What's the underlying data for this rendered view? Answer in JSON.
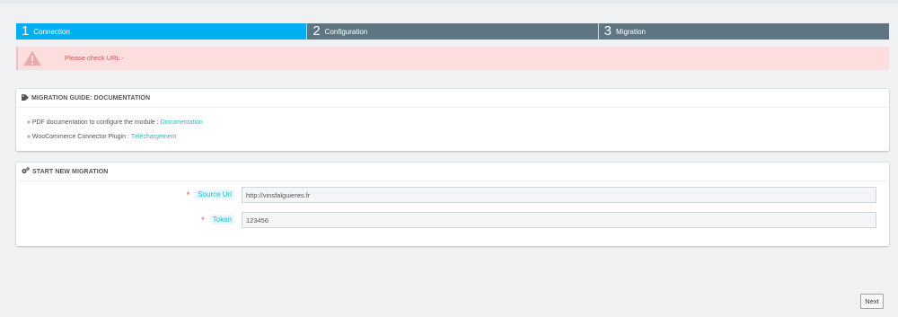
{
  "steps": [
    {
      "num": "1",
      "label": "Connection",
      "active": true
    },
    {
      "num": "2",
      "label": "Configuration",
      "active": false
    },
    {
      "num": "3",
      "label": "Migration",
      "active": false
    }
  ],
  "alert": {
    "message": "Please check URL -",
    "icon": "warning-icon"
  },
  "guide": {
    "title": "MIGRATION GUIDE: DOCUMENTATION",
    "icon": "tag-icon",
    "line1_text": "» PDF documentation to configure the module :",
    "line1_link": "Documentation",
    "line2_text": "» WooCommerce Connector Plugin :",
    "line2_link": "Téléchargement"
  },
  "migration": {
    "title": "START NEW MIGRATION",
    "icon": "cogs-icon",
    "fields": [
      {
        "label": "Source Url",
        "value": "http://vinsfalguieres.fr"
      },
      {
        "label": "Token",
        "value": "123456"
      }
    ]
  },
  "footer": {
    "next_label": "Next"
  },
  "colors": {
    "active_step": "#00aff0",
    "inactive_step": "#5e7684",
    "alert_bg": "#fcdede",
    "link": "#25b9d7",
    "required": "#e0403f"
  }
}
